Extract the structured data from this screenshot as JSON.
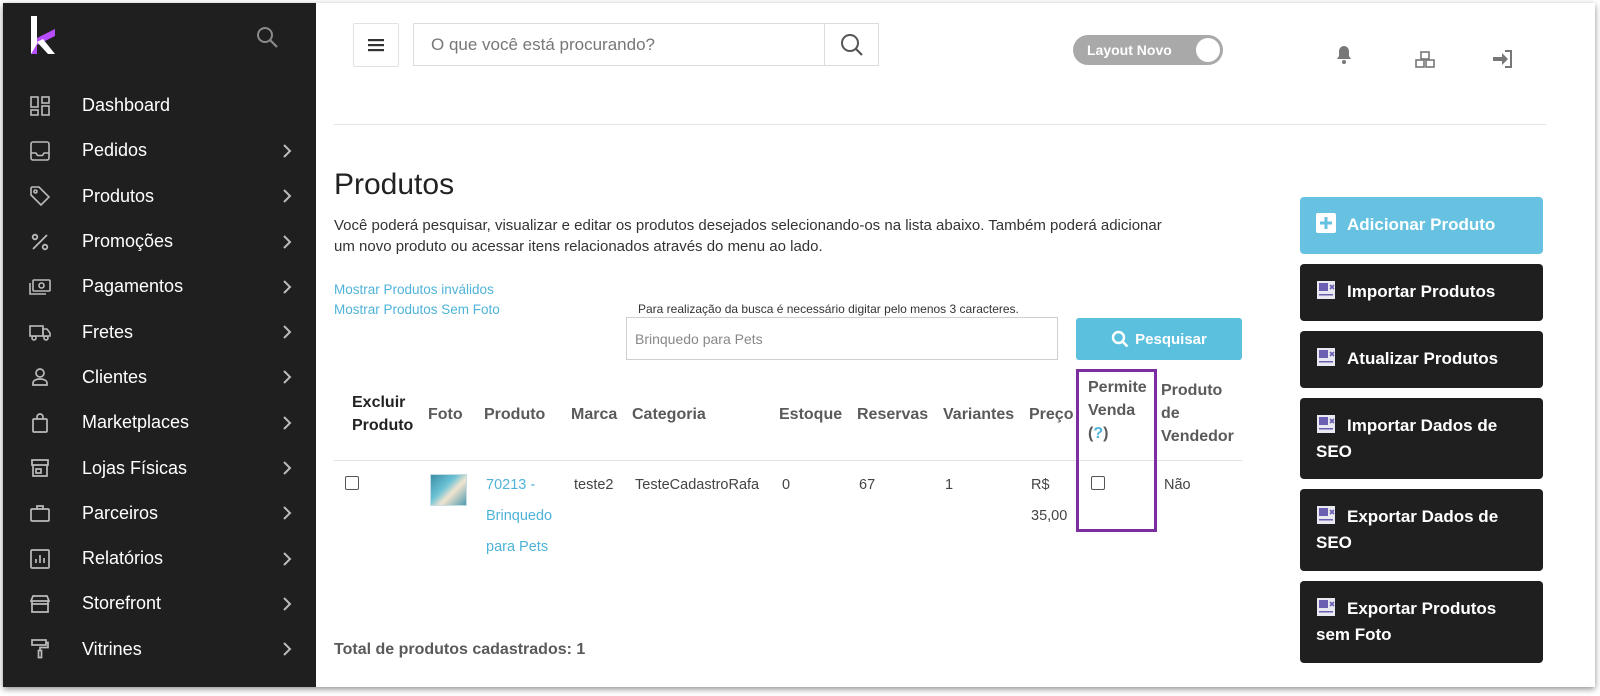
{
  "sidebar": {
    "items": [
      {
        "label": "Dashboard",
        "icon": "dashboard-icon",
        "chevron": false
      },
      {
        "label": "Pedidos",
        "icon": "inbox-icon",
        "chevron": true
      },
      {
        "label": "Produtos",
        "icon": "tag-icon",
        "chevron": true
      },
      {
        "label": "Promoções",
        "icon": "percent-icon",
        "chevron": true
      },
      {
        "label": "Pagamentos",
        "icon": "money-icon",
        "chevron": true
      },
      {
        "label": "Fretes",
        "icon": "truck-icon",
        "chevron": true
      },
      {
        "label": "Clientes",
        "icon": "user-icon",
        "chevron": true
      },
      {
        "label": "Marketplaces",
        "icon": "bag-icon",
        "chevron": true
      },
      {
        "label": "Lojas Físicas",
        "icon": "store-icon",
        "chevron": true
      },
      {
        "label": "Parceiros",
        "icon": "briefcase-icon",
        "chevron": true
      },
      {
        "label": "Relatórios",
        "icon": "report-icon",
        "chevron": true
      },
      {
        "label": "Storefront",
        "icon": "storefront-icon",
        "chevron": true
      },
      {
        "label": "Vitrines",
        "icon": "paint-roller-icon",
        "chevron": true
      }
    ]
  },
  "topbar": {
    "search_placeholder": "O que você está procurando?",
    "toggle_label": "Layout Novo"
  },
  "page": {
    "title": "Produtos",
    "description": "Você poderá pesquisar, visualizar e editar os produtos desejados selecionando-os na lista abaixo. Também poderá adicionar um novo produto ou acessar itens relacionados através do menu ao lado.",
    "link_invalid": "Mostrar Produtos inválidos",
    "link_no_photo": "Mostrar Produtos Sem Foto",
    "search_hint": "Para realização da busca é necessário digitar pelo menos 3 caracteres.",
    "search_value": "Brinquedo para Pets",
    "search_button": "Pesquisar",
    "total": "Total de produtos cadastrados: 1"
  },
  "table": {
    "headers": {
      "excluir": [
        "Excluir",
        "Produto"
      ],
      "foto": "Foto",
      "produto": "Produto",
      "marca": "Marca",
      "categoria": "Categoria",
      "estoque": "Estoque",
      "reservas": "Reservas",
      "variantes": "Variantes",
      "preco": "Preço",
      "permite": [
        "Permite",
        "Venda"
      ],
      "permite_help": "?",
      "vendedor": [
        "Produto",
        "de",
        "Vendedor"
      ]
    },
    "rows": [
      {
        "produto": [
          "70213 -",
          "Brinquedo",
          "para Pets"
        ],
        "marca": "teste2",
        "categoria": "TesteCadastroRafa",
        "estoque": "0",
        "reservas": "67",
        "variantes": "1",
        "preco": [
          "R$",
          "35,00"
        ],
        "vendedor": "Não"
      }
    ]
  },
  "actions": {
    "add": "Adicionar Produto",
    "import": "Importar Produtos",
    "update": "Atualizar Produtos",
    "import_seo": "Importar Dados de SEO",
    "export_seo": "Exportar Dados de SEO",
    "export_no_photo": "Exportar Produtos sem Foto"
  },
  "colors": {
    "sidebar_bg": "#1f1f1f",
    "accent": "#5bc0de",
    "link": "#4fb3d9",
    "highlight": "#7a2ea0",
    "logo_purple": "#a020f0"
  }
}
